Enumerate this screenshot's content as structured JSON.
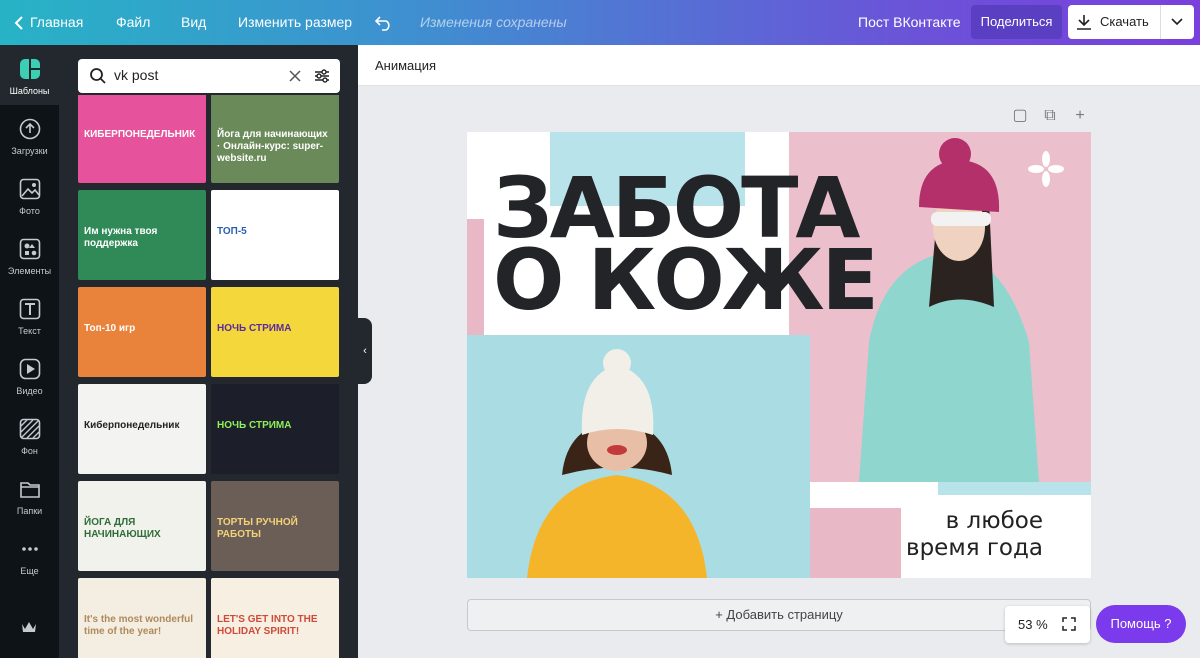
{
  "topbar": {
    "home": "Главная",
    "file": "Файл",
    "view": "Вид",
    "resize": "Изменить размер",
    "saved_status": "Изменения сохранены",
    "doc_title": "Пост ВКонтакте",
    "share": "Поделиться",
    "download": "Скачать"
  },
  "rail": {
    "items": [
      {
        "label": "Шаблоны",
        "icon": "templates-icon"
      },
      {
        "label": "Загрузки",
        "icon": "upload-icon"
      },
      {
        "label": "Фото",
        "icon": "photo-icon"
      },
      {
        "label": "Элементы",
        "icon": "elements-icon"
      },
      {
        "label": "Текст",
        "icon": "text-icon"
      },
      {
        "label": "Видео",
        "icon": "video-icon"
      },
      {
        "label": "Фон",
        "icon": "background-icon"
      },
      {
        "label": "Папки",
        "icon": "folder-icon"
      },
      {
        "label": "Еще",
        "icon": "more-icon"
      }
    ]
  },
  "search": {
    "value": "vk post"
  },
  "thumbs": [
    {
      "text": "КИБЕРПОНЕДЕЛЬНИК",
      "bg": "#e6539c",
      "fg": "#ffffff"
    },
    {
      "text": "Йога для начинающих · Онлайн-курс: super-website.ru",
      "bg": "#6a8a5a",
      "fg": "#ffffff"
    },
    {
      "text": "Им нужна твоя поддержка",
      "bg": "#2f8a57",
      "fg": "#ffffff"
    },
    {
      "text": "ТОП-5",
      "bg": "#ffffff",
      "fg": "#2a5fb0"
    },
    {
      "text": "Топ-10 игр",
      "bg": "#e9833b",
      "fg": "#ffffff"
    },
    {
      "text": "НОЧЬ СТРИМА",
      "bg": "#f4d73a",
      "fg": "#5a2aa0"
    },
    {
      "text": "Киберпонедельник",
      "bg": "#f3f3f1",
      "fg": "#222222"
    },
    {
      "text": "НОЧЬ СТРИМА",
      "bg": "#1c1f2a",
      "fg": "#8ff05a"
    },
    {
      "text": "ЙОГА ДЛЯ НАЧИНАЮЩИХ",
      "bg": "#f2f2ec",
      "fg": "#2e6d3a"
    },
    {
      "text": "ТОРТЫ РУЧНОЙ РАБОТЫ",
      "bg": "#6b5e56",
      "fg": "#f3d27a"
    },
    {
      "text": "It's the most wonderful time of the year!",
      "bg": "#f3ede2",
      "fg": "#b08a5a"
    },
    {
      "text": "LET'S GET INTO THE HOLIDAY SPIRIT!",
      "bg": "#f6efe2",
      "fg": "#d04a3a"
    }
  ],
  "subbar": {
    "animation": "Анимация"
  },
  "design": {
    "title_line1": "ЗАБОТА",
    "title_line2": "О КОЖЕ",
    "sub_line1": "в любое",
    "sub_line2": "время года",
    "colors": {
      "pink": "#e9b8c6",
      "blue": "#b9e3ea",
      "dark": "#222428"
    }
  },
  "add_page": "+ Добавить страницу",
  "zoom": "53 %",
  "help": "Помощь  ?"
}
